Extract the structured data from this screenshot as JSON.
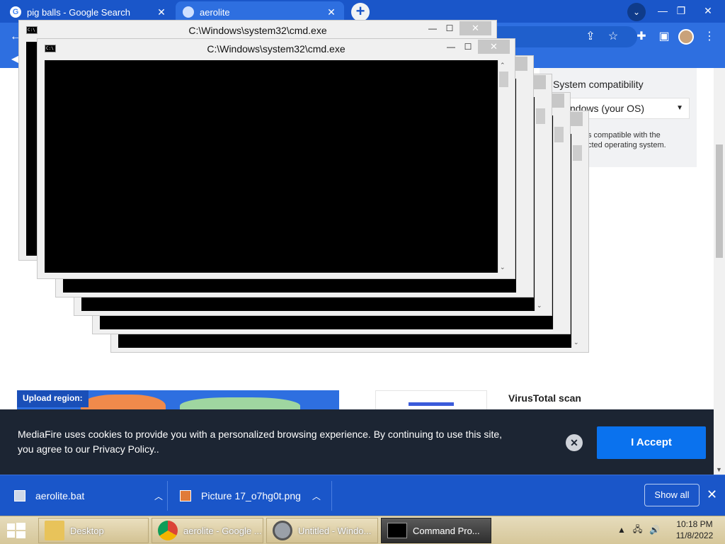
{
  "browser": {
    "tabs": [
      {
        "title": "pig balls - Google Search",
        "active": false
      },
      {
        "title": "aerolite",
        "active": true
      }
    ],
    "new_tab": "+",
    "tab_search": "⌄",
    "window_controls": {
      "minimize": "—",
      "maximize": "❐",
      "close": "✕"
    }
  },
  "page": {
    "compatibility": {
      "title": "System compatibility",
      "selected_os": "ndows (your OS)",
      "note_line1": "s compatible with the",
      "note_line2": "cted operating system."
    },
    "upload_region_label": "Upload region:",
    "virustotal_title": "VirusTotal scan",
    "cookie_banner": {
      "text": "MediaFire uses cookies to provide you with a personalized browsing experience. By continuing to use this site, you agree to our Privacy Policy..",
      "accept_label": "I Accept",
      "close_label": "✕"
    }
  },
  "downloads": {
    "items": [
      {
        "name": "aerolite.bat"
      },
      {
        "name": "Picture 17_o7hg0t.png"
      }
    ],
    "show_all": "Show all",
    "close": "✕"
  },
  "cmd_windows": [
    {
      "title": "C:\\Windows\\system32\\cmd.exe"
    },
    {
      "title": "C:\\Windows\\system32\\cmd.exe"
    }
  ],
  "taskbar": {
    "items": [
      {
        "label": "Desktop"
      },
      {
        "label": "aerolite - Google ..."
      },
      {
        "label": "Untitled - Windo..."
      },
      {
        "label": "Command Pro..."
      }
    ],
    "time": "10:18 PM",
    "date": "11/8/2022"
  },
  "colors": {
    "chrome_blue": "#1a56c9",
    "accept_button": "#0a72ee",
    "cookie_banner_bg": "#1c2533"
  }
}
